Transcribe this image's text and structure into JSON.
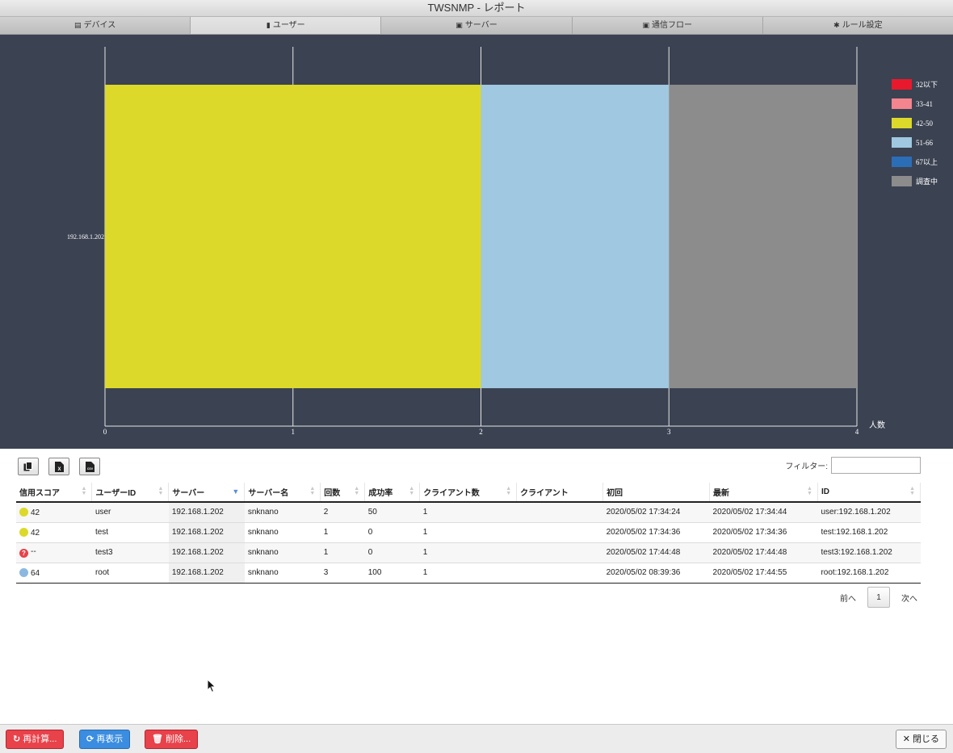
{
  "window": {
    "title": "TWSNMP - レポート"
  },
  "tabs": [
    {
      "label": "デバイス",
      "icon": "device-icon",
      "active": false
    },
    {
      "label": "ユーザー",
      "icon": "user-clipboard-icon",
      "active": true
    },
    {
      "label": "サーバー",
      "icon": "server-icon",
      "active": false
    },
    {
      "label": "通信フロー",
      "icon": "flow-icon",
      "active": false
    },
    {
      "label": "ルール設定",
      "icon": "gear-icon",
      "active": false
    }
  ],
  "chart_data": {
    "type": "bar",
    "orientation": "horizontal",
    "stacked": true,
    "categories": [
      "192.168.1.202"
    ],
    "series": [
      {
        "name": "32以下",
        "color": "#e8192c",
        "values": [
          0
        ]
      },
      {
        "name": "33-41",
        "color": "#f4858e",
        "values": [
          0
        ]
      },
      {
        "name": "42-50",
        "color": "#dcd92a",
        "values": [
          2
        ]
      },
      {
        "name": "51-66",
        "color": "#a0c8e0",
        "values": [
          1
        ]
      },
      {
        "name": "67以上",
        "color": "#2c6db8",
        "values": [
          0
        ]
      },
      {
        "name": "調査中",
        "color": "#8c8c8c",
        "values": [
          1
        ]
      }
    ],
    "xlim": [
      0,
      4
    ],
    "xticks": [
      "0",
      "1",
      "2",
      "3",
      "4"
    ],
    "xlabel": "人数",
    "grid": true,
    "legend": "right"
  },
  "toolbar": {
    "buttons": [
      {
        "name": "copy-button",
        "icon": "copy-icon"
      },
      {
        "name": "excel-button",
        "icon": "excel-icon"
      },
      {
        "name": "csv-button",
        "icon": "csv-icon"
      }
    ],
    "filter_label": "フィルター:",
    "filter_value": ""
  },
  "table": {
    "columns": [
      "信用スコア",
      "ユーザーID",
      "サーバー",
      "サーバー名",
      "回数",
      "成功率",
      "クライアント数",
      "クライアント",
      "初回",
      "最新",
      "ID"
    ],
    "rows": [
      {
        "score": "42",
        "score_color": "#dcd92a",
        "score_icon": "yellow-face-icon",
        "cells": [
          "user",
          "192.168.1.202",
          "snknano",
          "2",
          "50",
          "1",
          "",
          "2020/05/02 17:34:24",
          "2020/05/02 17:34:44",
          "user:192.168.1.202"
        ]
      },
      {
        "score": "42",
        "score_color": "#dcd92a",
        "score_icon": "yellow-face-icon",
        "cells": [
          "test",
          "192.168.1.202",
          "snknano",
          "1",
          "0",
          "1",
          "",
          "2020/05/02 17:34:36",
          "2020/05/02 17:34:36",
          "test:192.168.1.202"
        ]
      },
      {
        "score": "--",
        "score_color": "#e8424a",
        "score_icon": "question-icon",
        "cells": [
          "test3",
          "192.168.1.202",
          "snknano",
          "1",
          "0",
          "1",
          "",
          "2020/05/02 17:44:48",
          "2020/05/02 17:44:48",
          "test3:192.168.1.202"
        ]
      },
      {
        "score": "64",
        "score_color": "#8bb8e0",
        "score_icon": "blue-smile-icon",
        "cells": [
          "root",
          "192.168.1.202",
          "snknano",
          "3",
          "100",
          "1",
          "",
          "2020/05/02 08:39:36",
          "2020/05/02 17:44:55",
          "root:192.168.1.202"
        ]
      }
    ]
  },
  "pagination": {
    "prev": "前へ",
    "page": "1",
    "next": "次へ"
  },
  "buttons": {
    "recalc": "再計算...",
    "refresh": "再表示",
    "delete": "削除...",
    "close": "閉じる"
  }
}
